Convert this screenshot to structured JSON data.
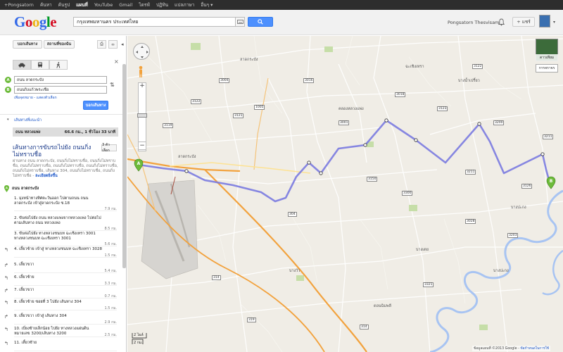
{
  "topbar": {
    "items": [
      "+Pongsatorn",
      "ค้นหา",
      "ค้นรูป",
      "แผนที่",
      "YouTube",
      "Gmail",
      "ไดรฟ์",
      "ปฏิทิน",
      "แปลภาษา",
      "อื่นๆ ▾"
    ],
    "active_index": 3
  },
  "header": {
    "logo": "Google",
    "search": {
      "value": "กรุงเทพมหานคร ประเทศไทย"
    },
    "user_name": "Pongsatorn Thesvisam",
    "share_label": "+ แชร์"
  },
  "panel": {
    "tabs": [
      "บอกเส้นทาง",
      "สถานที่ของฉัน"
    ],
    "start": {
      "marker": "A",
      "value": "ถนน ลาดกระบัง"
    },
    "end": {
      "marker": "B",
      "value": "ถนนกิ่งแก้วพระเชื่อ"
    },
    "add_destination": "เพิ่มจุดหมาย - แสดงตัวเลือก",
    "route_button": "บอกเส้นทาง",
    "show_options": "เส้นทางที่แนะนำ",
    "summary": {
      "road": "ถนน หลวงแพ่ง",
      "distance": "66.6 กม., 1 ชั่วโมง 33 นาที"
    },
    "title": "เส้นทางการขับรถไปยัง ถนนกิ่งไม่ทราบชื่อ",
    "options_button": "3 ตัวเลือก",
    "via_text": "ผ่านทาง ถนน ลาดกระบัง, ถนนกิ่งไม่ทราบชื่อ, ถนนกิ่งไม่ทราบชื่อ, ถนนกิ่งไม่ทราบชื่อ, ถนนกิ่งไม่ทราบชื่อ, ถนนกิ่งไม่ทราบชื่อ, ถนนกิ่งไม่ทราบชื่อ, เส้นทาง 304, ถนนกิ่งไม่ทราบชื่อ, ถนนกิ่งไม่ทราบชื่อ - ",
    "via_link": "ละเอียดยิ่งขึ้น",
    "start_label": "ถนน ลาดกระบัง",
    "steps": [
      {
        "icon": "",
        "text": "1. มุ่งหน้าทางทิศตะวันออก ไปตามถนน ถนน ลาดกระบัง เข้าสู่ลาดกระบัง ซ.18",
        "dist": "7.9 กม."
      },
      {
        "icon": "",
        "text": "2. ขับต่อไปยัง ถนน หลวงแพ่งจากหลวงแพ่ง ไปต่อไปตามเส้นทาง ถนน หลวงแพ่ง",
        "dist": "8.5 กม."
      },
      {
        "icon": "",
        "text": "3. ขับต่อไปยัง ทางหลวงชนบท ฉะเชิงเทรา 3001 ทางหลวงชนบท ฉะเชิงเทรา 3001",
        "dist": "5.6 กม."
      },
      {
        "icon": "↰",
        "text": "4. เลี้ยวซ้าย เข้าสู่ ทางหลวงชนบท ฉะเชิงเทรา 3028",
        "dist": "1.5 กม."
      },
      {
        "icon": "↱",
        "text": "5. เลี้ยวขวา",
        "dist": "5.4 กม."
      },
      {
        "icon": "↰",
        "text": "6. เลี้ยวซ้าย",
        "dist": "3.3 กม."
      },
      {
        "icon": "↱",
        "text": "7. เลี้ยวขวา",
        "dist": "0.7 กม."
      },
      {
        "icon": "↰",
        "text": "8. เลี้ยวซ้าย ซอยที่ 3 ไปยัง เส้นทาง 304",
        "dist": "1.5 กม."
      },
      {
        "icon": "↱",
        "text": "9. เลี้ยวขวา เข้าสู่ เส้นทาง 304",
        "dist": "2.9 กม."
      },
      {
        "icon": "↰",
        "text": "10. เบี่ยงซ้ายเล็กน้อย ไปยัง ทางหลวงแผ่นดินหมายเลข 3200/เส้นทาง 3200",
        "dist": "2.5 กม."
      },
      {
        "icon": "↰",
        "text": "11. เลี้ยวซ้าย",
        "dist": ""
      }
    ]
  },
  "map": {
    "satellite_label": "ดาวเทียม",
    "traffic_label": "การจราจร",
    "scale": [
      "2 ไมล์",
      "2 กม."
    ],
    "copyright": "ข้อมูลแผนที่ ©2013 Google - ",
    "copyright_link": "ข้อกำหนดในการใช้",
    "labels": [
      "ลาดกระบัง",
      "ลาดกระบัง",
      "ฉะเชิงเทรา",
      "บางปะกง",
      "บางน้ำเปรี้ยว",
      "คลองหลวงแพ่ง",
      "บางวัว",
      "บางเตย",
      "ดอนฉิมพลี",
      "บางปะกง"
    ],
    "road_shields": [
      "3119",
      "304",
      "3200",
      "3001",
      "3018",
      "3123",
      "1005",
      "3122",
      "3016",
      "3211",
      "3126",
      "3150",
      "3004",
      "3121",
      "3203",
      "3300",
      "3321",
      "314",
      "319",
      "3028",
      "3211",
      "3122",
      "314"
    ]
  },
  "colors": {
    "route": "#7a7ae0",
    "highway": "#f2a23d",
    "river": "#a8c4f2",
    "accent": "#4d90fe"
  }
}
